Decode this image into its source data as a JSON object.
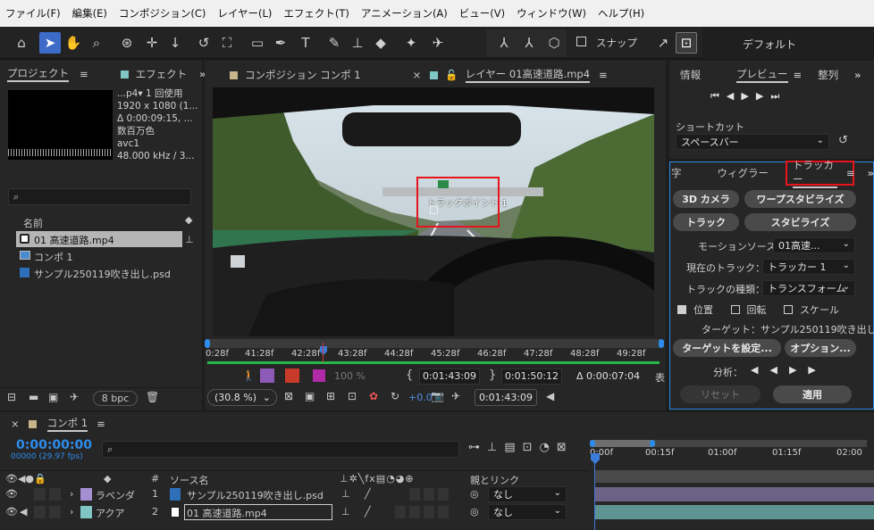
{
  "menu": [
    "ファイル(F)",
    "編集(E)",
    "コンポジション(C)",
    "レイヤー(L)",
    "エフェクト(T)",
    "アニメーション(A)",
    "ビュー(V)",
    "ウィンドウ(W)",
    "ヘルプ(H)"
  ],
  "toolbar": {
    "snap_label": "スナップ",
    "workspace": "デフォルト"
  },
  "project": {
    "tab_project": "プロジェクト",
    "tab_effects": "エフェクト",
    "info": [
      "...p4▾ 1 回使用",
      "1920 x 1080 (1...",
      "Δ 0:00:09:15, ...",
      "数百万色",
      "avc1",
      "48.000 kHz / 3..."
    ],
    "search_placeholder": "",
    "col_name": "名前",
    "items": [
      "01 高速道路.mp4",
      "コンポ 1",
      "サンプル250119吹き出し.psd"
    ],
    "bpc": "8 bpc"
  },
  "viewer": {
    "tab_comp": "コンポジション コンポ 1",
    "tab_layer": "レイヤー 01高速道路.mp4",
    "track_point_label": "トラックポイント 1",
    "ruler": [
      "0:28f",
      "41:28f",
      "42:28f",
      "43:28f",
      "44:28f",
      "45:28f",
      "46:28f",
      "47:28f",
      "48:28f",
      "49:28f"
    ],
    "res_percent": "100 %",
    "time_current": "0:01:43:09",
    "time_out": "0:01:50:12",
    "duration": "Δ 0:00:07:04",
    "zoom": "(30.8 %)",
    "exposure": "+0.0",
    "time_bottom": "0:01:43:09"
  },
  "info_panel": {
    "tab_info": "情報",
    "tab_preview": "プレビュー",
    "tab_align": "整列",
    "shortcut_label": "ショートカット",
    "shortcut_value": "スペースバー"
  },
  "tracker": {
    "tab_char": "字",
    "tab_wiggler": "ウィグラー",
    "tab_tracker": "トラッカー",
    "btn_3d": "3D カメラ",
    "btn_warp": "ワープスタビライズ",
    "btn_track": "トラック",
    "btn_stabilize": "スタビライズ",
    "motion_source_label": "モーションソース：",
    "motion_source_value": "01高速...",
    "current_track_label": "現在のトラック：",
    "current_track_value": "トラッカー 1",
    "track_type_label": "トラックの種類：",
    "track_type_value": "トランスフォーム",
    "position_label": "位置",
    "rotation_label": "回転",
    "scale_label": "スケール",
    "target_text": "ターゲット：サンプル250119吹き出し.psd",
    "btn_set_target": "ターゲットを設定...",
    "btn_options": "オプション...",
    "analyze_label": "分析：",
    "btn_reset": "リセット",
    "btn_apply": "適用"
  },
  "timeline": {
    "comp_tab": "コンポ 1",
    "timecode": "0:00:00:00",
    "timecode_sub": "00000 (29.97 fps)",
    "search_placeholder": "",
    "col_num": "#",
    "col_source": "ソース名",
    "col_parent": "親とリンク",
    "ruler": [
      "0:00f",
      "00:15f",
      "01:00f",
      "01:15f",
      "02:00"
    ],
    "layers": [
      {
        "label": "ラベンダ",
        "num": "1",
        "name": "サンプル250119吹き出し.psd",
        "parent": "なし",
        "color": "#a38fd1"
      },
      {
        "label": "アクア",
        "num": "2",
        "name": "01 高速道路.mp4",
        "parent": "なし",
        "color": "#7fc6c4"
      }
    ]
  },
  "colors": {
    "accent_blue": "#2d8ceb",
    "highlight_red": "#e8141c",
    "playhead": "#3d7bd8",
    "work_area_green": "#28b84a"
  }
}
